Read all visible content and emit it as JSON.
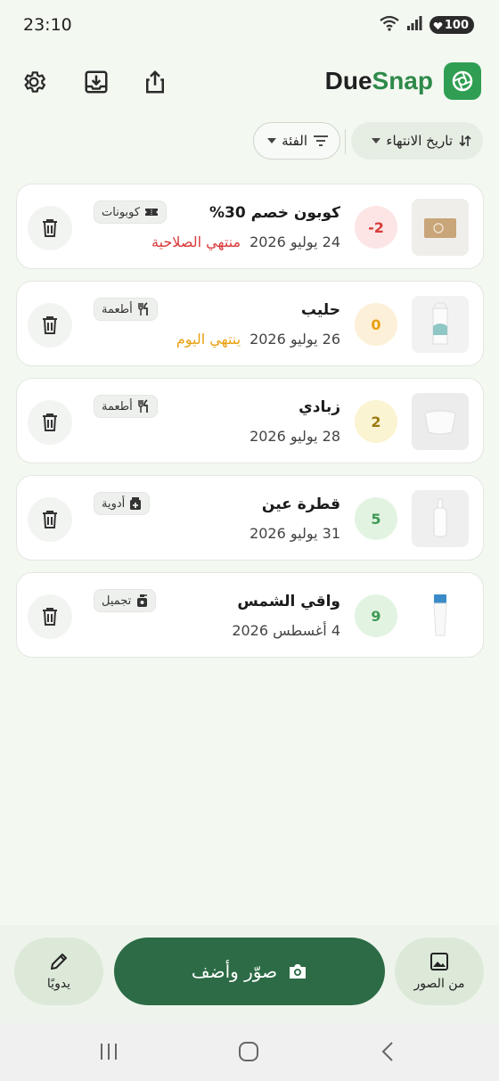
{
  "status_bar": {
    "time": "23:10",
    "battery": "100"
  },
  "app": {
    "brand_due": "Due",
    "brand_snap": "Snap"
  },
  "toolbar": {
    "settings": "gear-icon",
    "import": "download-tray-icon",
    "share": "share-icon"
  },
  "filters": {
    "sort_label": "تاريخ الانتهاء",
    "category_label": "الفئة"
  },
  "items": [
    {
      "title": "كوبون خصم 30%",
      "date": "24 يوليو 2026",
      "status": "منتهي الصلاحية",
      "days": "-2",
      "tag": "كوبونات",
      "tag_icon": "ticket-icon",
      "thumb": "coupon-image",
      "days_color": "#d93a3a",
      "days_bg": "#fde5e5"
    },
    {
      "title": "حليب",
      "date": "26 يوليو 2026",
      "status": "ينتهي اليوم",
      "days": "0",
      "tag": "أطعمة",
      "tag_icon": "fork-knife-icon",
      "thumb": "milk-carton-image",
      "days_color": "#e8a010",
      "days_bg": "#fdf0d8"
    },
    {
      "title": "زبادي",
      "date": "28 يوليو 2026",
      "status": "",
      "days": "2",
      "tag": "أطعمة",
      "tag_icon": "fork-knife-icon",
      "thumb": "yogurt-cup-image",
      "days_color": "#9a7a10",
      "days_bg": "#fbf4d2"
    },
    {
      "title": "قطرة عين",
      "date": "31 يوليو 2026",
      "status": "",
      "days": "5",
      "tag": "أدوية",
      "tag_icon": "medicine-icon",
      "thumb": "eye-drops-image",
      "days_color": "#3e9a55",
      "days_bg": "#e3f3e2"
    },
    {
      "title": "واقي الشمس",
      "date": "4 أغسطس 2026",
      "status": "",
      "days": "9",
      "tag": "تجميل",
      "tag_icon": "spray-bottle-icon",
      "thumb": "sunscreen-tube-image",
      "days_color": "#3e9a55",
      "days_bg": "#e3f3e2"
    }
  ],
  "bottom": {
    "manual_label": "يدويًا",
    "capture_label": "صوّر وأضف",
    "gallery_label": "من الصور"
  },
  "colors": {
    "accent": "#2c6b45",
    "brand_green": "#2e8a4a",
    "background": "#f3f8f1"
  }
}
